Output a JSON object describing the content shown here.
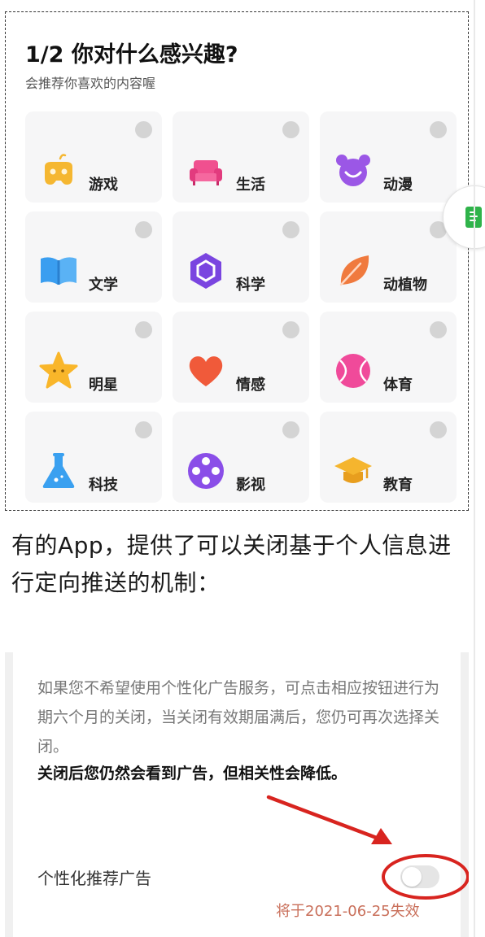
{
  "interests": {
    "title": "1/2 你对什么感兴趣?",
    "subtitle": "会推荐你喜欢的内容喔",
    "categories": [
      {
        "label": "游戏",
        "icon": "gamepad-icon",
        "color": "#f5b731"
      },
      {
        "label": "生活",
        "icon": "sofa-icon",
        "color": "#f0508f"
      },
      {
        "label": "动漫",
        "icon": "bear-face-icon",
        "color": "#9b57e6"
      },
      {
        "label": "文学",
        "icon": "book-icon",
        "color": "#3a9ef0"
      },
      {
        "label": "科学",
        "icon": "hexagon-icon",
        "color": "#7a45e0"
      },
      {
        "label": "动植物",
        "icon": "leaf-icon",
        "color": "#f07a3e"
      },
      {
        "label": "明星",
        "icon": "star-icon",
        "color": "#f9b62a"
      },
      {
        "label": "情感",
        "icon": "heart-icon",
        "color": "#f05a3a"
      },
      {
        "label": "体育",
        "icon": "ball-icon",
        "color": "#f04a9a"
      },
      {
        "label": "科技",
        "icon": "flask-icon",
        "color": "#3aa0f0"
      },
      {
        "label": "影视",
        "icon": "film-reel-icon",
        "color": "#8a4ee8"
      },
      {
        "label": "教育",
        "icon": "graduation-cap-icon",
        "color": "#f5b52e"
      }
    ]
  },
  "article": {
    "text": "有的App，提供了可以关闭基于个人信息进行定向推送的机制："
  },
  "settings": {
    "description": "如果您不希望使用个性化广告服务，可点击相应按钮进行为期六个月的关闭，当关闭有效期届满后，您仍可再次选择关闭。",
    "bold_note": "关闭后您仍然会看到广告，但相关性会降低。",
    "toggle_label": "个性化推荐广告",
    "toggle_on": false,
    "expiry": "将于2021-06-25失效",
    "annotation_color": "#d8241f"
  }
}
